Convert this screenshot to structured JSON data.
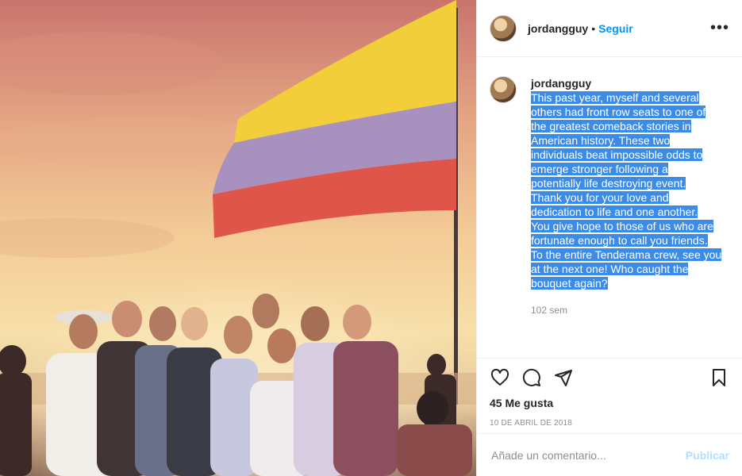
{
  "post": {
    "username": "jordangguy",
    "separator": "•",
    "follow_label": "Seguir",
    "more_label": "•••",
    "caption_username": "jordangguy",
    "caption_lines": [
      "This past year, myself and several",
      "others had front row seats to one of",
      "the greatest comeback stories in",
      "American history. These two",
      "individuals beat impossible odds to",
      "emerge stronger following a",
      "potentially life destroying event.",
      "Thank you for your love and",
      "dedication to life and one another.",
      "You give hope to those of us who are",
      "fortunate enough to call you friends.",
      "To the entire Tenderama crew, see you",
      "at the next one! Who caught the",
      "bouquet again?"
    ],
    "time_ago": "102 sem",
    "likes": "45 Me gusta",
    "date": "10 DE ABRIL DE 2018",
    "comment_placeholder": "Añade un comentario...",
    "publish_label": "Publicar"
  },
  "icons": [
    "heart-icon",
    "comment-icon",
    "share-icon",
    "bookmark-icon"
  ],
  "colors": {
    "link": "#0095f6",
    "highlight": "#3c8ce7",
    "publish_disabled": "#b2dffc"
  }
}
